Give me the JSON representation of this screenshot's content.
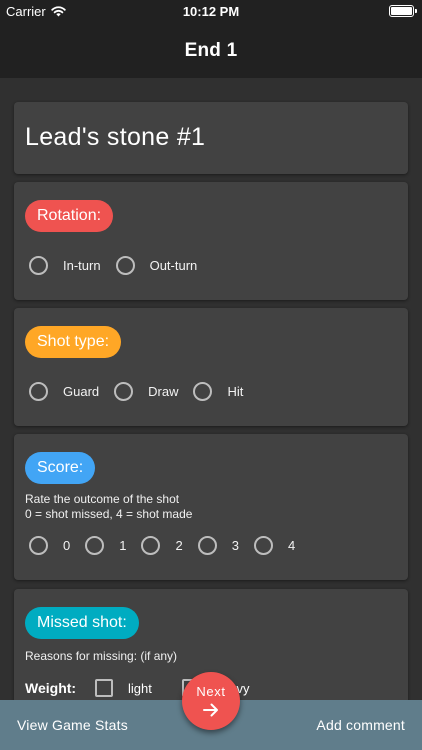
{
  "status_bar": {
    "carrier": "Carrier",
    "time": "10:12 PM"
  },
  "app_bar": {
    "title": "End 1"
  },
  "stone_card": {
    "heading": "Lead's stone #1"
  },
  "rotation": {
    "label": "Rotation:",
    "options": [
      "In-turn",
      "Out-turn"
    ],
    "color": "#ef5350"
  },
  "shot_type": {
    "label": "Shot type:",
    "options": [
      "Guard",
      "Draw",
      "Hit"
    ],
    "color": "#ffa726"
  },
  "score": {
    "label": "Score:",
    "description_line1": "Rate the outcome of the shot",
    "description_line2": "0 = shot missed, 4 = shot made",
    "options": [
      "0",
      "1",
      "2",
      "3",
      "4"
    ],
    "color": "#42a5f5"
  },
  "missed_shot": {
    "label": "Missed shot:",
    "description": "Reasons for missing: (if any)",
    "weight_label": "Weight:",
    "weight_options": [
      "light",
      "heavy"
    ],
    "color": "#00acc1"
  },
  "bottom_bar": {
    "view_stats": "View Game Stats",
    "add_comment": "Add comment"
  },
  "fab": {
    "label": "Next",
    "icon": "arrow-right-icon"
  }
}
